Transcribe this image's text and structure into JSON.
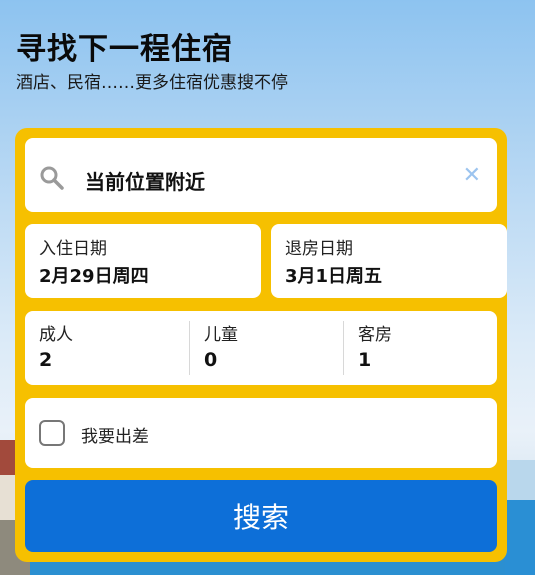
{
  "hero": {
    "title": "寻找下一程住宿",
    "subtitle": "酒店、民宿……更多住宿优惠搜不停"
  },
  "search": {
    "location_text": "当前位置附近",
    "clear_icon": "close-icon",
    "search_icon": "search-icon"
  },
  "dates": {
    "checkin_label": "入住日期",
    "checkin_value": "2月29日周四",
    "checkout_label": "退房日期",
    "checkout_value": "3月1日周五"
  },
  "guests": [
    {
      "label": "成人",
      "value": "2"
    },
    {
      "label": "儿童",
      "value": "0"
    },
    {
      "label": "客房",
      "value": "1"
    }
  ],
  "business": {
    "label": "我要出差",
    "checked": false
  },
  "search_button": {
    "label": "搜索"
  },
  "colors": {
    "panel": "#f6c000",
    "button": "#0d6fd8"
  }
}
